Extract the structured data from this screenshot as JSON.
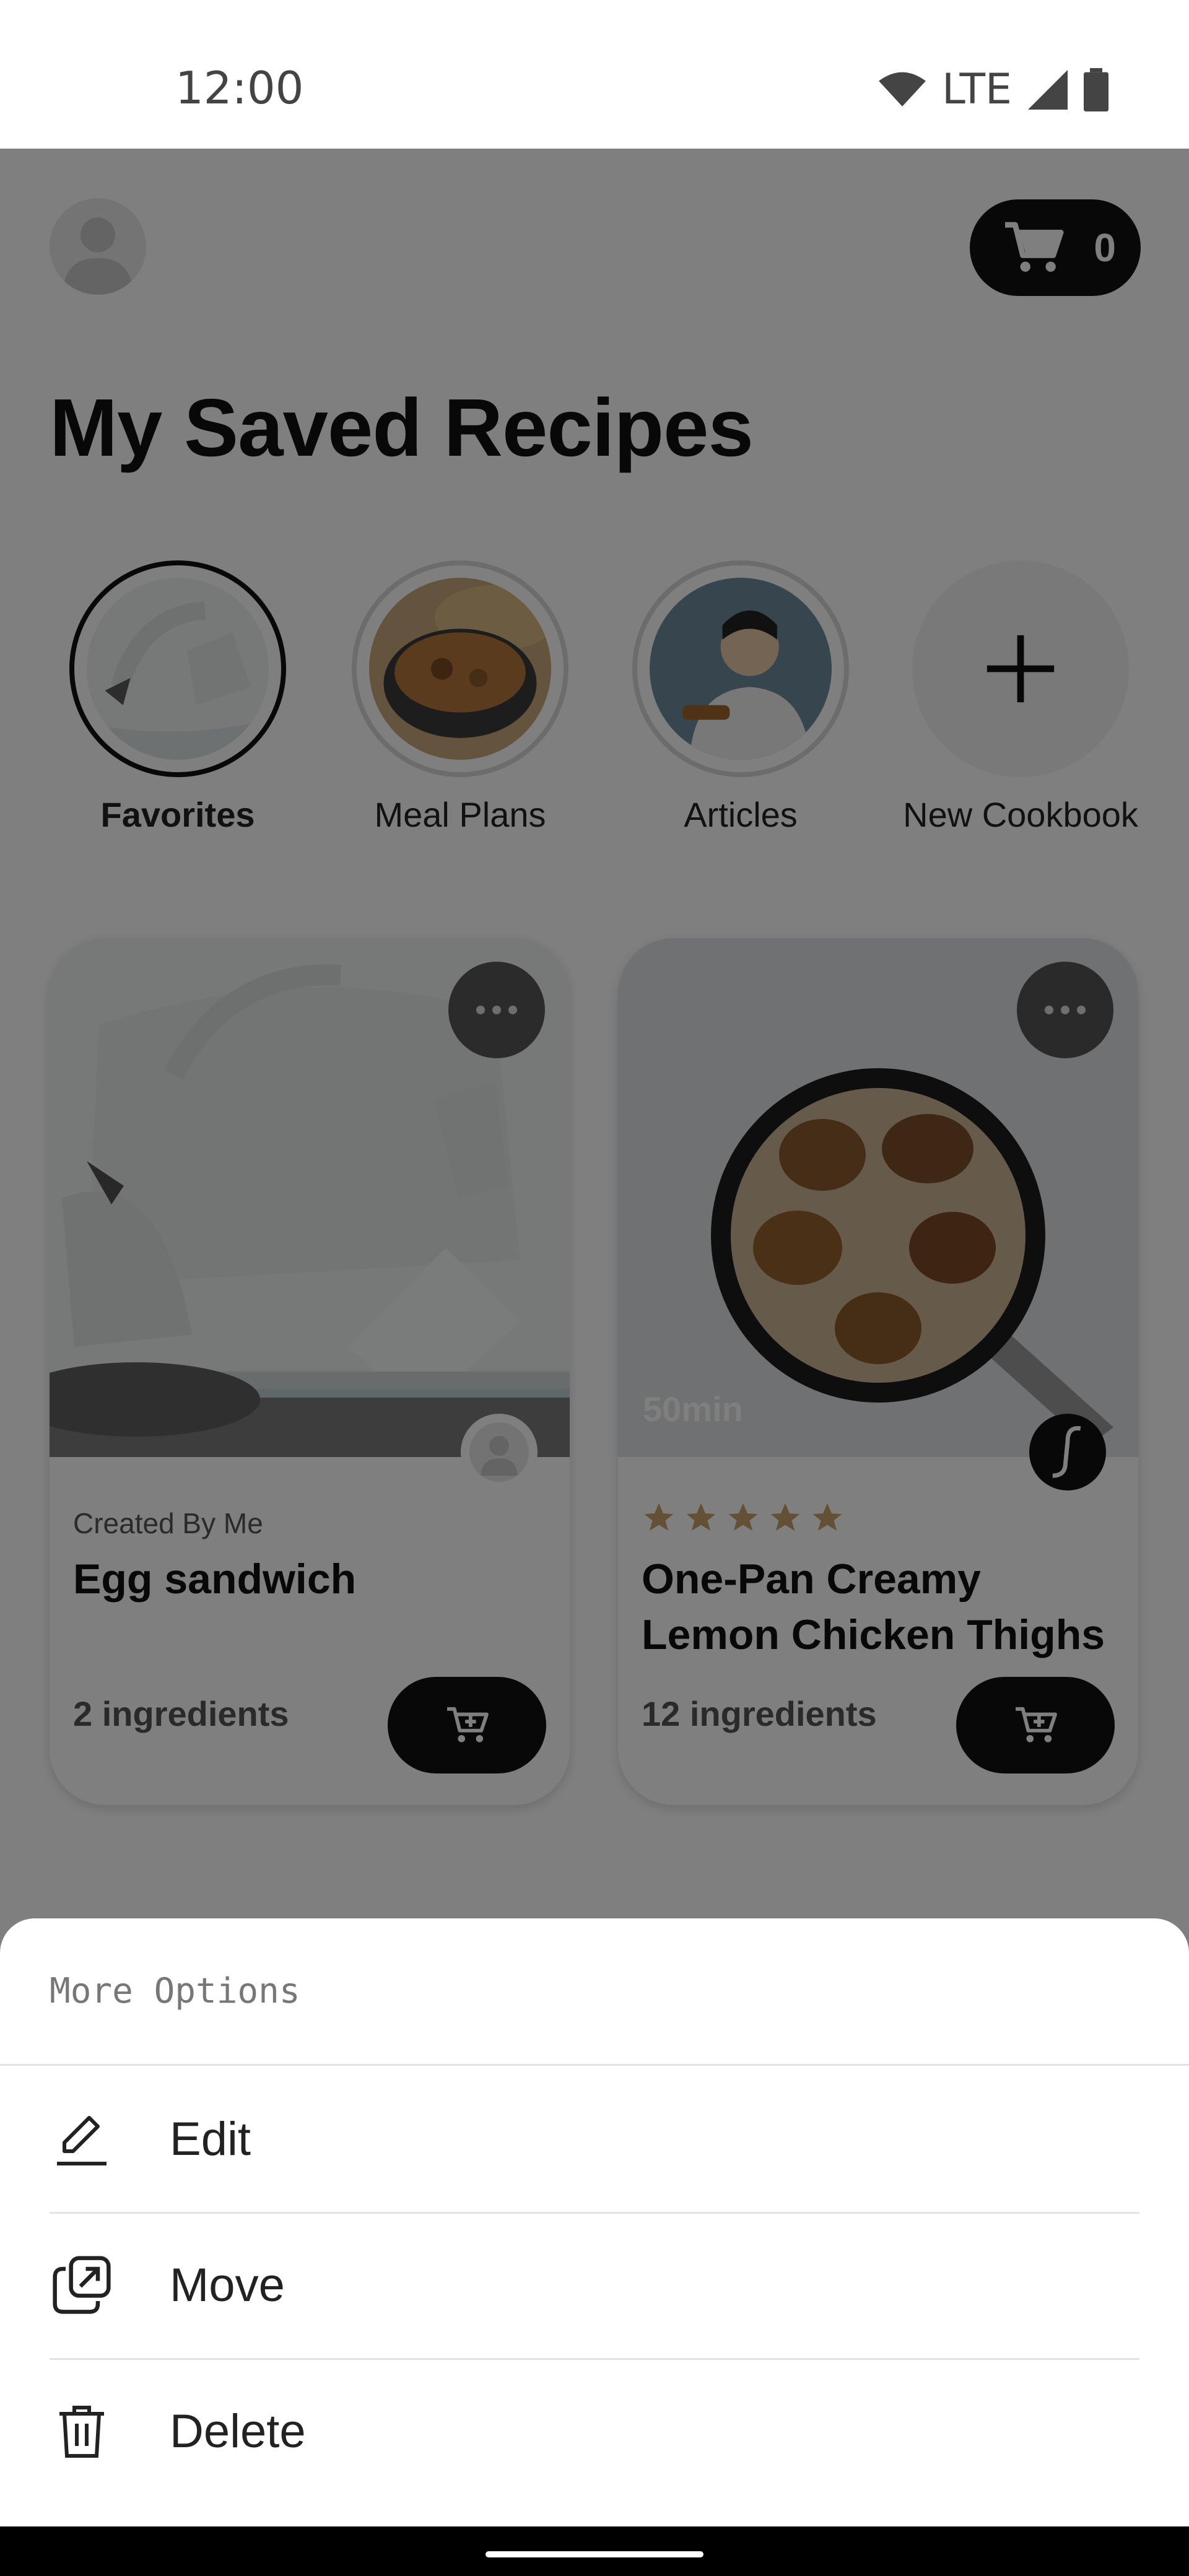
{
  "status_bar": {
    "time": "12:00",
    "network": "LTE",
    "icons": [
      "wifi-icon",
      "cell-signal-icon",
      "battery-icon"
    ]
  },
  "header": {
    "cart_count": "0",
    "icons": [
      "avatar-icon",
      "cart-icon"
    ]
  },
  "page": {
    "title": "My Saved Recipes"
  },
  "collections": [
    {
      "label": "Favorites",
      "active": true
    },
    {
      "label": "Meal Plans",
      "active": false
    },
    {
      "label": "Articles",
      "active": false
    },
    {
      "label": "New Cookbook",
      "active": false
    }
  ],
  "cards": [
    {
      "meta": "Created By Me",
      "title": "Egg sandwich",
      "ingredients": "2 ingredients"
    },
    {
      "time": "50min",
      "rating": 5,
      "title": "One-Pan Creamy Lemon Chicken Thighs",
      "ingredients": "12 ingredients"
    }
  ],
  "sheet": {
    "title": "More Options",
    "items": [
      {
        "label": "Edit",
        "icon": "pencil-icon"
      },
      {
        "label": "Move",
        "icon": "move-icon"
      },
      {
        "label": "Delete",
        "icon": "trash-icon"
      }
    ]
  },
  "colors": {
    "accent": "#111111",
    "star": "#c8a06a",
    "scrim": "rgba(0,0,0,0.5)"
  }
}
